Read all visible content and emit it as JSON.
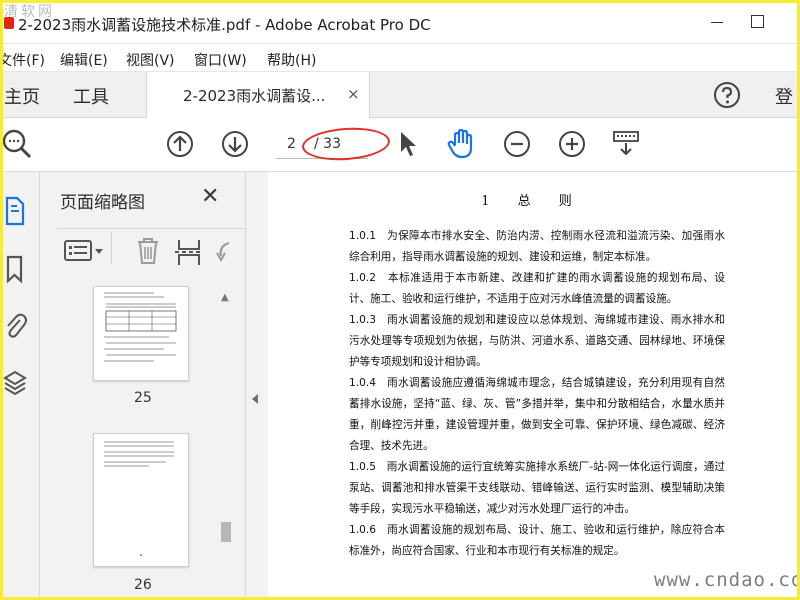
{
  "window": {
    "title": "2-2023雨水调蓄设施技术标准.pdf - Adobe Acrobat Pro DC",
    "watermark_top": "清软网"
  },
  "menu": [
    "文件(F)",
    "编辑(E)",
    "视图(V)",
    "窗口(W)",
    "帮助(H)"
  ],
  "tabs": {
    "home": "主页",
    "tools": "工具",
    "document": "2-2023雨水调蓄设...",
    "close": "×",
    "login": "登"
  },
  "toolbar": {
    "current_page": "2",
    "total_pages": "/ 33"
  },
  "thumbnail_pane": {
    "title": "页面缩略图",
    "close": "✕",
    "thumbnails": [
      {
        "page": "25"
      },
      {
        "page": "26"
      }
    ]
  },
  "document": {
    "heading": "1 总 则",
    "paragraphs": [
      "1.0.1　为保障本市排水安全、防治内涝、控制雨水径流和溢流污染、加强雨水综合利用，指导雨水调蓄设施的规划、建设和运维，制定本标准。",
      "1.0.2　本标准适用于本市新建、改建和扩建的雨水调蓄设施的规划布局、设计、施工、验收和运行维护，不适用于应对污水峰值流量的调蓄设施。",
      "1.0.3　雨水调蓄设施的规划和建设应以总体规划、海绵城市建设、雨水排水和污水处理等专项规划为依据，与防洪、河道水系、道路交通、园林绿地、环境保护等专项规划和设计相协调。",
      "1.0.4　雨水调蓄设施应遵循海绵城市理念，结合城镇建设，充分利用现有自然蓄排水设施，坚持“蓝、绿、灰、管”多措并举，集中和分散相结合，水量水质并重，削峰控污并重，建设管理并重，做到安全可靠、保护环境、绿色减碳、经济合理、技术先进。",
      "1.0.5　雨水调蓄设施的运行宜统筹实施排水系统厂-站-网一体化运行调度，通过泵站、调蓄池和排水管渠干支线联动、错峰输送、运行实时监测、模型辅助决策等手段，实现污水平稳输送，减少对污水处理厂运行的冲击。",
      "1.0.6　雨水调蓄设施的规划布局、设计、施工、验收和运行维护，除应符合本标准外，尚应符合国家、行业和本市现行有关标准的规定。"
    ]
  },
  "watermark_bottom": "www.cndao.com",
  "colors": {
    "frame": "#f7ec32",
    "annotation": "#e0322a",
    "hand_tool": "#1a73e8",
    "app_icon": "#e1251b"
  }
}
